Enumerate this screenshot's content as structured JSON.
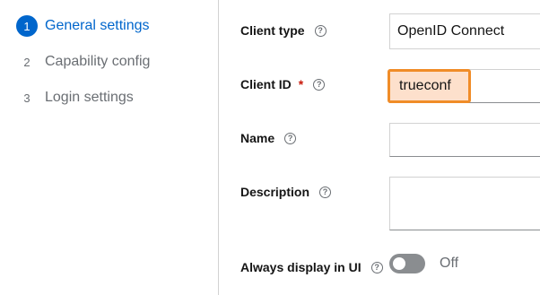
{
  "wizard": {
    "steps": [
      {
        "number": "1",
        "label": "General settings",
        "active": true
      },
      {
        "number": "2",
        "label": "Capability config",
        "active": false
      },
      {
        "number": "3",
        "label": "Login settings",
        "active": false
      }
    ]
  },
  "form": {
    "client_type": {
      "label": "Client type",
      "value": "OpenID Connect"
    },
    "client_id": {
      "label": "Client ID",
      "required_mark": "*",
      "value": "trueconf"
    },
    "name": {
      "label": "Name",
      "value": ""
    },
    "description": {
      "label": "Description",
      "value": ""
    },
    "always_display": {
      "label": "Always display in UI",
      "state_text": "Off",
      "enabled": false
    }
  },
  "help_glyph": "?",
  "icons": {
    "help": "question-circle-icon"
  },
  "colors": {
    "accent": "#0066cc",
    "highlight_border": "#f08c28",
    "highlight_fill": "#fde0cc",
    "required": "#c9190b"
  }
}
